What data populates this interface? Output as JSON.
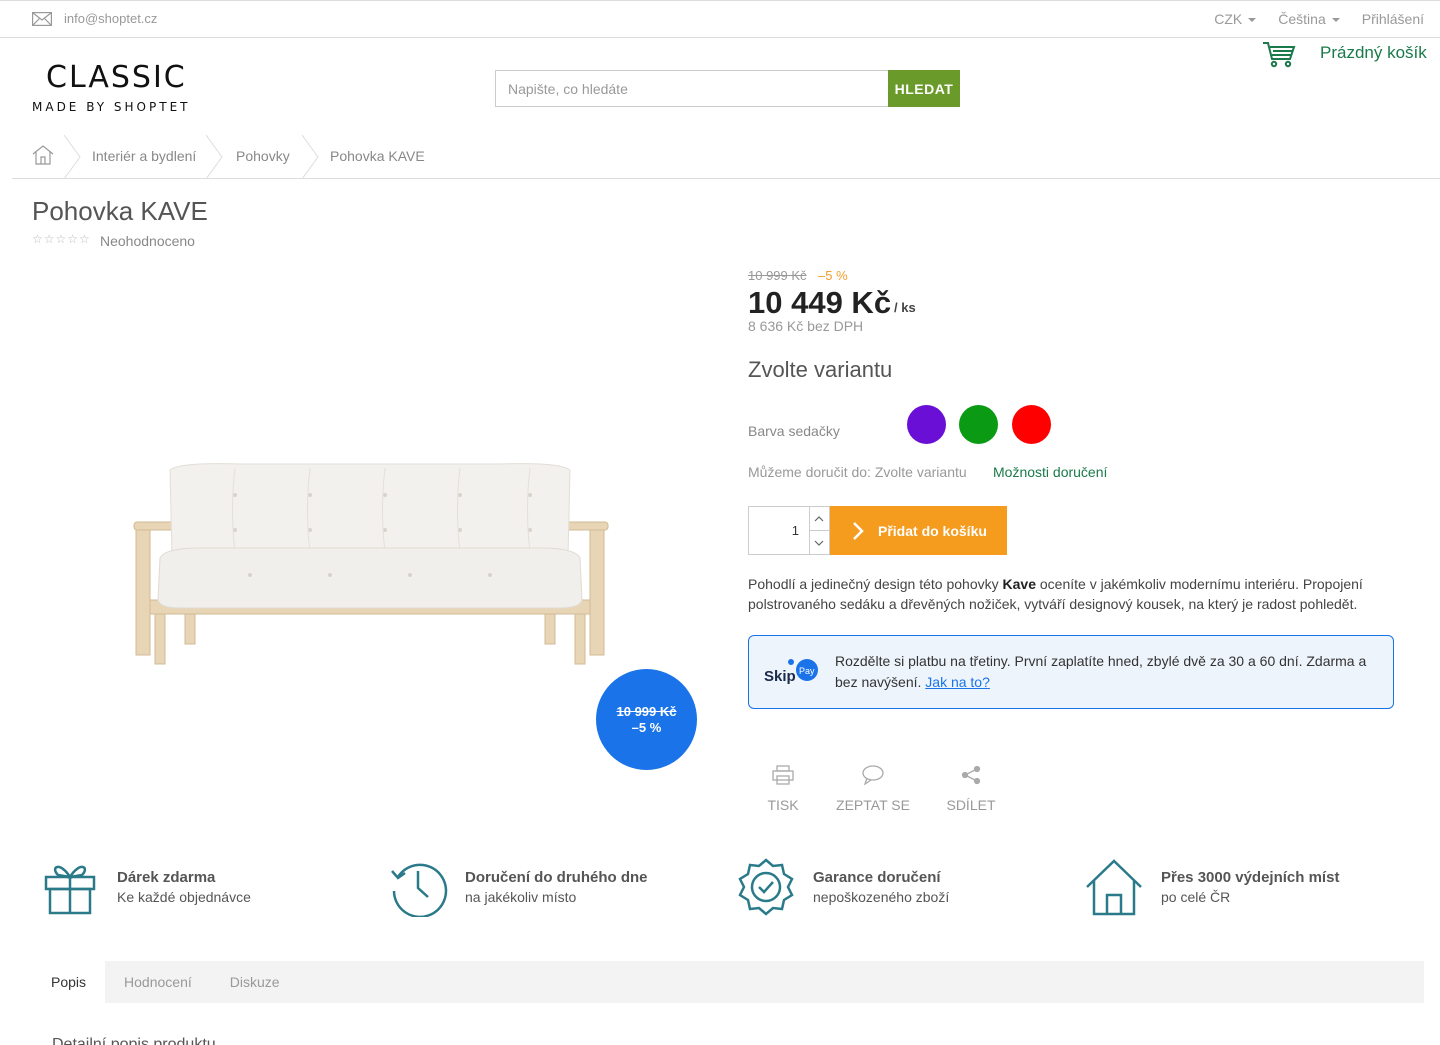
{
  "topbar": {
    "email": "info@shoptet.cz",
    "currency": "CZK",
    "language": "Čeština",
    "login": "Přihlášení"
  },
  "header": {
    "logo_main": "CLASSIC",
    "logo_sub": "MADE BY SHOPTET",
    "search_placeholder": "Napište, co hledáte",
    "search_button": "HLEDAT",
    "cart_label": "Prázdný košík"
  },
  "breadcrumb": {
    "items": [
      "Interiér a bydlení",
      "Pohovky",
      "Pohovka KAVE"
    ]
  },
  "product": {
    "title": "Pohovka KAVE",
    "stars": "☆☆☆☆☆",
    "rating_text": "Neohodnoceno",
    "old_price": "10 999 Kč",
    "discount": "–5 %",
    "price": "10 449 Kč",
    "unit": "/ ks",
    "price_net": "8 636 Kč bez DPH",
    "badge_old": "10 999 Kč",
    "badge_discount": "–5 %",
    "variant_heading": "Zvolte variantu",
    "variant_label": "Barva sedačky",
    "swatches": [
      {
        "name": "purple",
        "color": "#6a0fd6"
      },
      {
        "name": "green",
        "color": "#0a9a14"
      },
      {
        "name": "red",
        "color": "#ff0000"
      }
    ],
    "deliver_text": "Můžeme doručit do: Zvolte variantu",
    "deliver_link": "Možnosti doručení",
    "quantity": "1",
    "add_to_cart": "Přidat do košíku",
    "desc_part1": "Pohodlí a jedinečný design této pohovky ",
    "desc_bold": "Kave",
    "desc_part2": "  oceníte v jakémkoliv modernímu interiéru. Propojení polstrovaného sedáku a dřevěných nožiček, vytváří designový kousek, na který je radost pohledět."
  },
  "skippay": {
    "logo_text": "Skip",
    "logo_badge": "Pay",
    "text": "Rozdělte si platbu na třetiny. První zaplatíte hned, zbylé dvě za 30 a 60 dní. Zdarma a bez navýšení. ",
    "link": "Jak na to?"
  },
  "actions": {
    "print": "TISK",
    "ask": "ZEPTAT SE",
    "share": "SDÍLET"
  },
  "benefits": [
    {
      "title": "Dárek zdarma",
      "sub": "Ke každé objednávce",
      "icon": "gift-icon"
    },
    {
      "title": "Doručení do druhého dne",
      "sub": "na jakékoliv místo",
      "icon": "clock-history-icon"
    },
    {
      "title": "Garance doručení",
      "sub": "nepoškozeného zboží",
      "icon": "badge-check-icon"
    },
    {
      "title": "Přes 3000 výdejních míst",
      "sub": "po celé ČR",
      "icon": "house-icon"
    }
  ],
  "tabs": [
    "Popis",
    "Hodnocení",
    "Diskuze"
  ],
  "below_tabs": "Detailní popis produktu",
  "colors": {
    "search_button": "#6a9a2a",
    "cart_green": "#1a7a4a",
    "add_to_cart": "#f59b1e",
    "discount_badge": "#1a73e8",
    "discount_text": "#f29d2a",
    "benefit_icons": "#2a7a8a"
  }
}
